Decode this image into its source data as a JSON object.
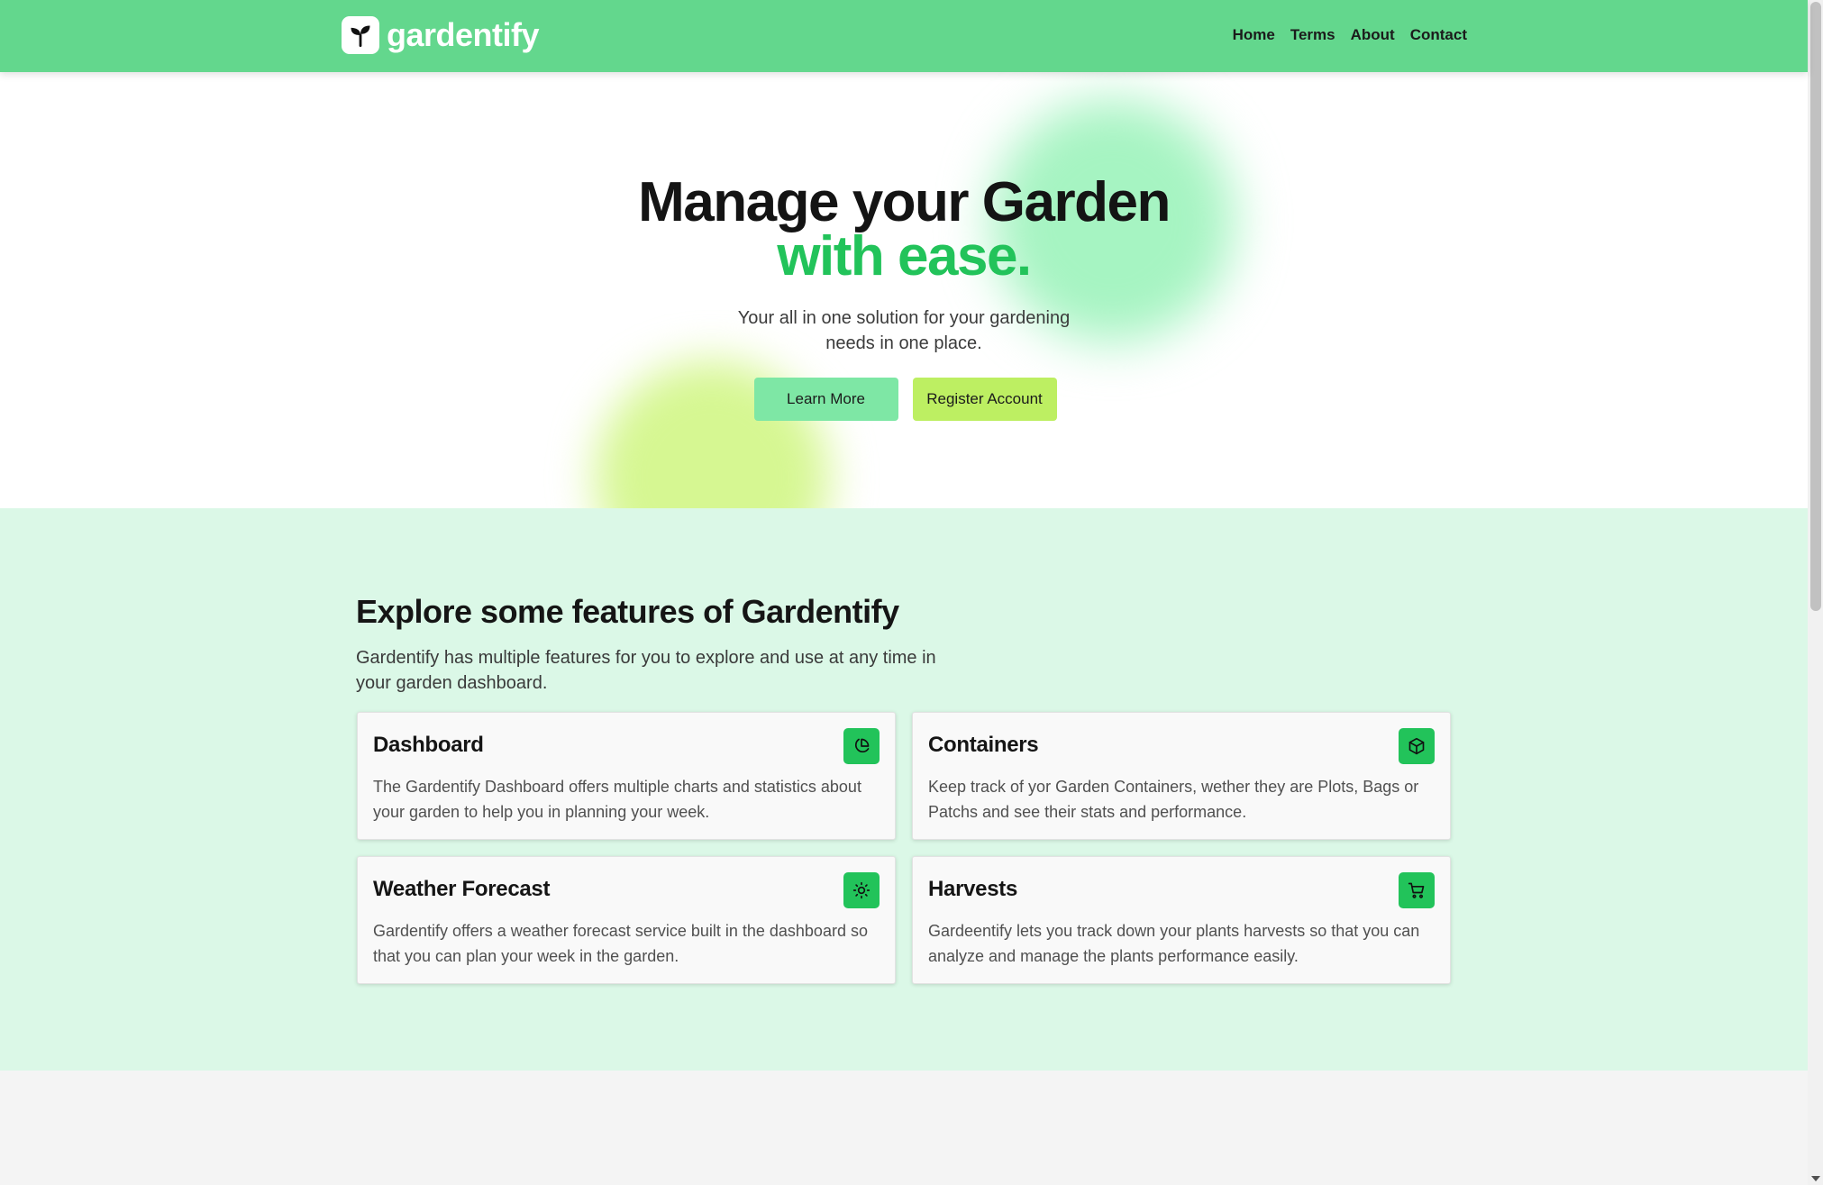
{
  "brand": {
    "name": "gardentify",
    "icon": "sprout-icon"
  },
  "nav": {
    "links": [
      "Home",
      "Terms",
      "About",
      "Contact"
    ]
  },
  "hero": {
    "title_line1": "Manage your Garden",
    "title_line2": "with ease.",
    "subtitle": "Your all in one solution for your gardening needs in one place.",
    "learn_more": "Learn More",
    "register": "Register Account"
  },
  "features": {
    "title": "Explore some features of Gardentify",
    "subtitle": "Gardentify has multiple features for you to explore and use at any time in your garden dashboard.",
    "cards": [
      {
        "title": "Dashboard",
        "text": "The Gardentify Dashboard offers multiple charts and statistics about your garden to help you in planning your week.",
        "icon": "pie-chart-icon"
      },
      {
        "title": "Containers",
        "text": "Keep track of yor Garden Containers, wether they are Plots, Bags or Patchs and see their stats and performance.",
        "icon": "cube-icon"
      },
      {
        "title": "Weather Forecast",
        "text": "Gardentify offers a weather forecast service built in the dashboard so that you can plan your week in the garden.",
        "icon": "sun-icon"
      },
      {
        "title": "Harvests",
        "text": "Gardeentify lets you track down your plants harvests so that you can analyze and manage the plants performance easily.",
        "icon": "cart-icon"
      }
    ]
  },
  "colors": {
    "nav": "#63d78d",
    "accent": "#22c35a",
    "features_bg": "#dbf8e7",
    "learn_btn": "#7ee7a5",
    "register_btn": "#bdef62"
  }
}
